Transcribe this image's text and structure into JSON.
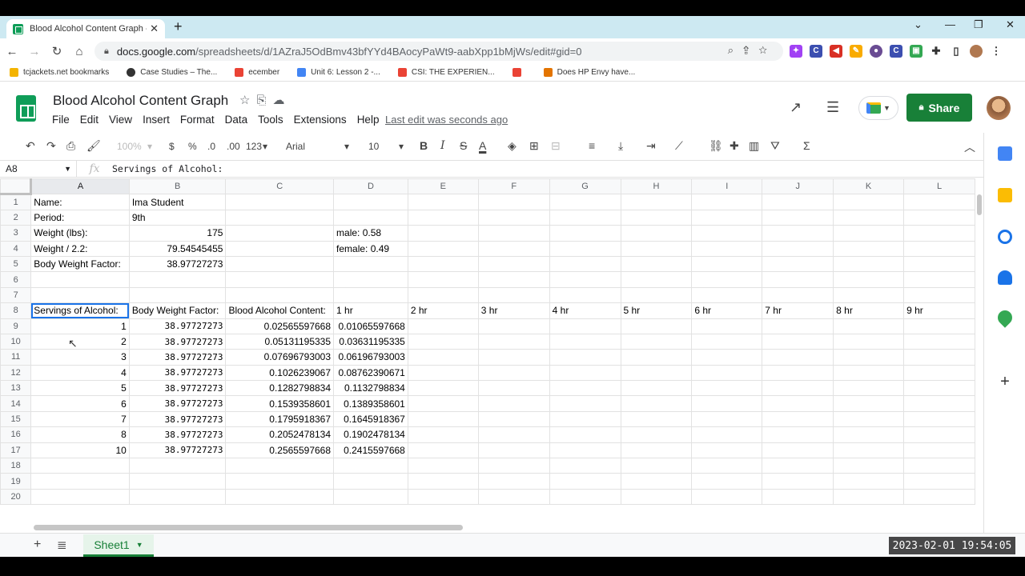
{
  "browser": {
    "tab_title": "Blood Alcohol Content Graph - G",
    "url_host": "docs.google.com",
    "url_path": "/spreadsheets/d/1AZraJ5OdBmv43bfYYd4BAocyPaWt9-aabXpp1bMjWs/edit#gid=0",
    "bookmarks": [
      {
        "label": "tcjackets.net bookmarks",
        "color": "#f4b400"
      },
      {
        "label": "Case Studies – The...",
        "color": "#333333"
      },
      {
        "label": "ecember",
        "color": "#ea4335"
      },
      {
        "label": "Unit 6: Lesson 2 -...",
        "color": "#4285f4"
      },
      {
        "label": "CSI: THE EXPERIEN...",
        "color": "#ea4335"
      },
      {
        "label": "",
        "color": "#ea4335"
      },
      {
        "label": "Does HP Envy have...",
        "color": "#e37400"
      }
    ]
  },
  "sheets": {
    "title": "Blood Alcohol Content Graph",
    "menus": [
      "File",
      "Edit",
      "View",
      "Insert",
      "Format",
      "Data",
      "Tools",
      "Extensions",
      "Help"
    ],
    "last_edit": "Last edit was seconds ago",
    "share_label": "Share",
    "toolbar": {
      "zoom": "100%",
      "currency": "$",
      "percent": "%",
      "dec_less": ".0",
      "dec_more": ".00",
      "more_formats": "123",
      "font": "Arial",
      "font_size": "10"
    },
    "namebox": "A8",
    "formula": "Servings of Alcohol:",
    "columns": [
      "A",
      "B",
      "C",
      "D",
      "E",
      "F",
      "G",
      "H",
      "I",
      "J",
      "K",
      "L"
    ],
    "sheet_tab": "Sheet1"
  },
  "grid": {
    "rows": [
      [
        "Name:",
        "Ima Student",
        "",
        "",
        "",
        "",
        "",
        "",
        "",
        "",
        "",
        ""
      ],
      [
        "Period:",
        "9th",
        "",
        "",
        "",
        "",
        "",
        "",
        "",
        "",
        "",
        ""
      ],
      [
        "Weight (lbs):",
        "175",
        "",
        "male: 0.58",
        "",
        "",
        "",
        "",
        "",
        "",
        "",
        ""
      ],
      [
        "Weight / 2.2:",
        "79.54545455",
        "",
        "female: 0.49",
        "",
        "",
        "",
        "",
        "",
        "",
        "",
        ""
      ],
      [
        "Body Weight Factor:",
        "38.97727273",
        "",
        "",
        "",
        "",
        "",
        "",
        "",
        "",
        "",
        ""
      ],
      [
        "",
        "",
        "",
        "",
        "",
        "",
        "",
        "",
        "",
        "",
        "",
        ""
      ],
      [
        "",
        "",
        "",
        "",
        "",
        "",
        "",
        "",
        "",
        "",
        "",
        ""
      ],
      [
        "Servings of Alcohol:",
        "Body Weight Factor:",
        "Blood Alcohol Content:",
        "1 hr",
        "2 hr",
        "3 hr",
        "4 hr",
        "5 hr",
        "6 hr",
        "7 hr",
        "8 hr",
        "9 hr"
      ],
      [
        "1",
        "38.97727273",
        "0.02565597668",
        "0.01065597668",
        "",
        "",
        "",
        "",
        "",
        "",
        "",
        ""
      ],
      [
        "2",
        "38.97727273",
        "0.05131195335",
        "0.03631195335",
        "",
        "",
        "",
        "",
        "",
        "",
        "",
        ""
      ],
      [
        "3",
        "38.97727273",
        "0.07696793003",
        "0.06196793003",
        "",
        "",
        "",
        "",
        "",
        "",
        "",
        ""
      ],
      [
        "4",
        "38.97727273",
        "0.1026239067",
        "0.08762390671",
        "",
        "",
        "",
        "",
        "",
        "",
        "",
        ""
      ],
      [
        "5",
        "38.97727273",
        "0.1282798834",
        "0.1132798834",
        "",
        "",
        "",
        "",
        "",
        "",
        "",
        ""
      ],
      [
        "6",
        "38.97727273",
        "0.1539358601",
        "0.1389358601",
        "",
        "",
        "",
        "",
        "",
        "",
        "",
        ""
      ],
      [
        "7",
        "38.97727273",
        "0.1795918367",
        "0.1645918367",
        "",
        "",
        "",
        "",
        "",
        "",
        "",
        ""
      ],
      [
        "8",
        "38.97727273",
        "0.2052478134",
        "0.1902478134",
        "",
        "",
        "",
        "",
        "",
        "",
        "",
        ""
      ],
      [
        "10",
        "38.97727273",
        "0.2565597668",
        "0.2415597668",
        "",
        "",
        "",
        "",
        "",
        "",
        "",
        ""
      ],
      [
        "",
        "",
        "",
        "",
        "",
        "",
        "",
        "",
        "",
        "",
        "",
        ""
      ],
      [
        "",
        "",
        "",
        "",
        "",
        "",
        "",
        "",
        "",
        "",
        "",
        ""
      ],
      [
        "",
        "",
        "",
        "",
        "",
        "",
        "",
        "",
        "",
        "",
        "",
        ""
      ]
    ]
  },
  "timestamp": "2023-02-01 19:54:05"
}
